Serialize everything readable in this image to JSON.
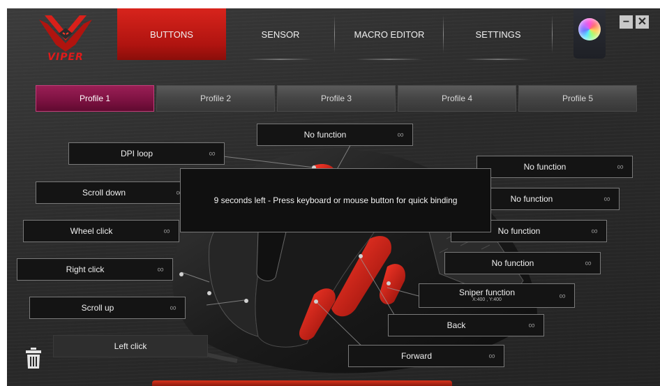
{
  "brand": {
    "logo_text": "VIPER"
  },
  "nav": {
    "tabs": [
      {
        "label": "BUTTONS",
        "active": true
      },
      {
        "label": "SENSOR",
        "active": false
      },
      {
        "label": "MACRO EDITOR",
        "active": false
      },
      {
        "label": "SETTINGS",
        "active": false
      }
    ]
  },
  "window": {
    "minimize_glyph": "−",
    "close_glyph": "✕"
  },
  "profiles": [
    {
      "label": "Profile 1",
      "active": true
    },
    {
      "label": "Profile 2",
      "active": false
    },
    {
      "label": "Profile 3",
      "active": false
    },
    {
      "label": "Profile 4",
      "active": false
    },
    {
      "label": "Profile 5",
      "active": false
    }
  ],
  "bindings": {
    "top": "No function",
    "dpi_loop": "DPI loop",
    "scroll_down": "Scroll down",
    "wheel_click": "Wheel click",
    "right_click": "Right click",
    "scroll_up": "Scroll up",
    "left_click": "Left click",
    "right_1": "No function",
    "right_2": "No function",
    "right_3": "No function",
    "right_4": "No function",
    "sniper": "Sniper function",
    "sniper_sub": "X:400 , Y:400",
    "back": "Back",
    "forward": "Forward"
  },
  "link_glyph": "∞",
  "dialog": {
    "message": "9 seconds left - Press keyboard or mouse button for quick binding"
  },
  "colors": {
    "accent_red": "#c81a14",
    "profile_active": "#7e1242"
  }
}
